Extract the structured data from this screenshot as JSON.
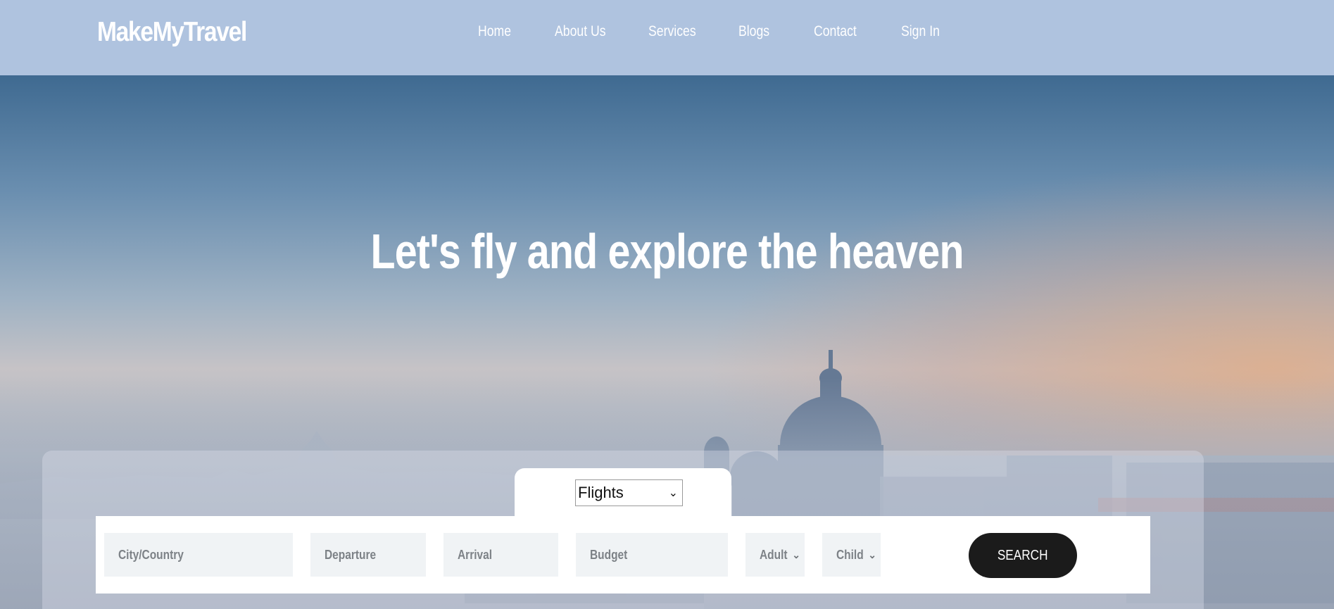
{
  "header": {
    "brand": "MakeMyTravel",
    "nav": [
      {
        "label": "Home"
      },
      {
        "label": "About Us"
      },
      {
        "label": "Services"
      },
      {
        "label": "Blogs"
      },
      {
        "label": "Contact"
      },
      {
        "label": "Sign In"
      }
    ]
  },
  "hero": {
    "headline": "Let's fly and explore the heaven"
  },
  "search": {
    "category_selected": "Flights",
    "fields": {
      "city": "City/Country",
      "departure": "Departure",
      "arrival": "Arrival",
      "budget": "Budget",
      "adult": "Adult",
      "child": "Child"
    },
    "button_label": "SEARCH"
  },
  "colors": {
    "header_bg": "#afc3df",
    "button_bg": "#1b1b1b",
    "field_bg": "#f0f3f5"
  }
}
